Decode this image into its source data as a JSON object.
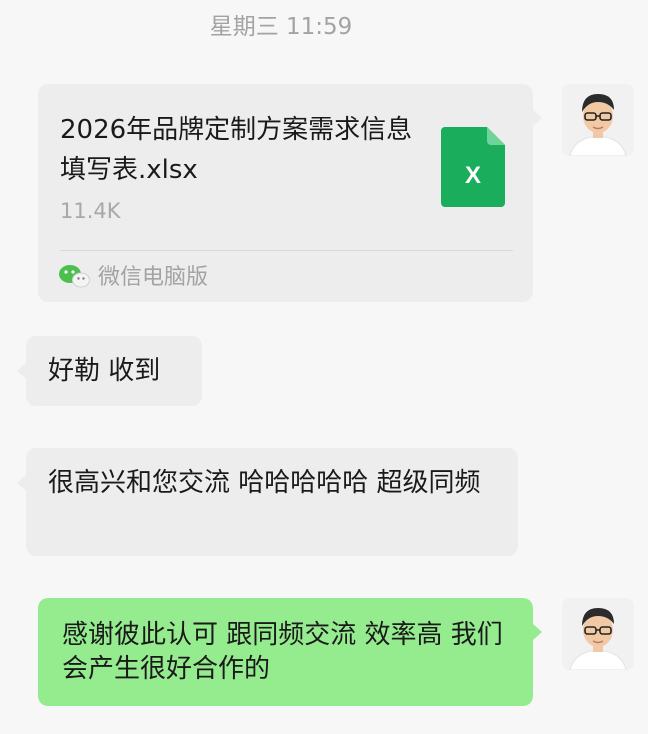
{
  "timestamp": "星期三 11:59",
  "file_message": {
    "file_name": "2026年品牌定制方案需求信息填写表.xlsx",
    "file_size": "11.4K",
    "file_icon": "excel-file-icon",
    "file_icon_letter": "X",
    "source": "微信电脑版",
    "source_icon": "wechat-icon"
  },
  "messages": [
    {
      "text": "好勒  收到"
    },
    {
      "text": "很高兴和您交流 哈哈哈哈哈  超级同频"
    },
    {
      "text": "感谢彼此认可 跟同频交流 效率高 我们会产生很好合作的"
    }
  ],
  "colors": {
    "received_bubble": "#ededed",
    "sent_bubble": "#95ec8f",
    "excel_green": "#1aad5c",
    "background": "#f7f7f7",
    "timestamp_text": "#a3a3a3"
  }
}
